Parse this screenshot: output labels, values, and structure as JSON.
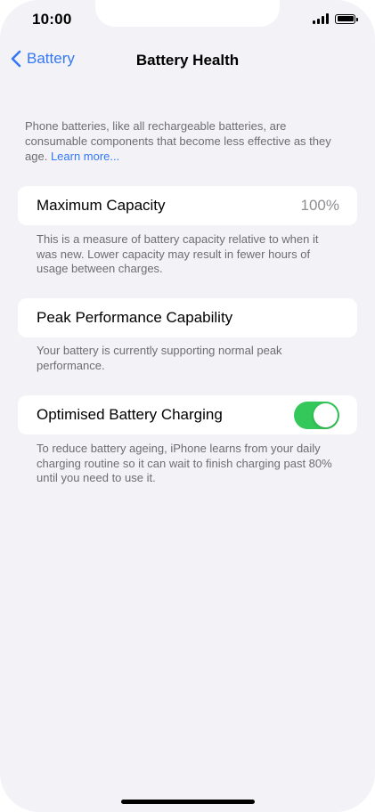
{
  "status_bar": {
    "time": "10:00",
    "icons": [
      "cellular-signal-icon",
      "battery-icon"
    ]
  },
  "nav": {
    "back_label": "Battery",
    "back_icon": "chevron-left-icon",
    "title": "Battery Health"
  },
  "intro": {
    "text": "Phone batteries, like all rechargeable batteries, are consumable components that become less effective as they age.",
    "link": "Learn more..."
  },
  "maximum_capacity": {
    "label": "Maximum Capacity",
    "value": "100%",
    "footer": "This is a measure of battery capacity relative to when it was new. Lower capacity may result in fewer hours of usage between charges."
  },
  "peak_performance": {
    "label": "Peak Performance Capability",
    "footer": "Your battery is currently supporting normal peak performance."
  },
  "optimised_charging": {
    "label": "Optimised Battery Charging",
    "enabled": true,
    "footer": "To reduce battery ageing, iPhone learns from your daily charging routine so it can wait to finish charging past 80% until you need to use it."
  },
  "colors": {
    "accent": "#3478f6",
    "toggle_on": "#34c759",
    "background": "#f2f2f7",
    "secondary_text": "#6d6d72"
  }
}
